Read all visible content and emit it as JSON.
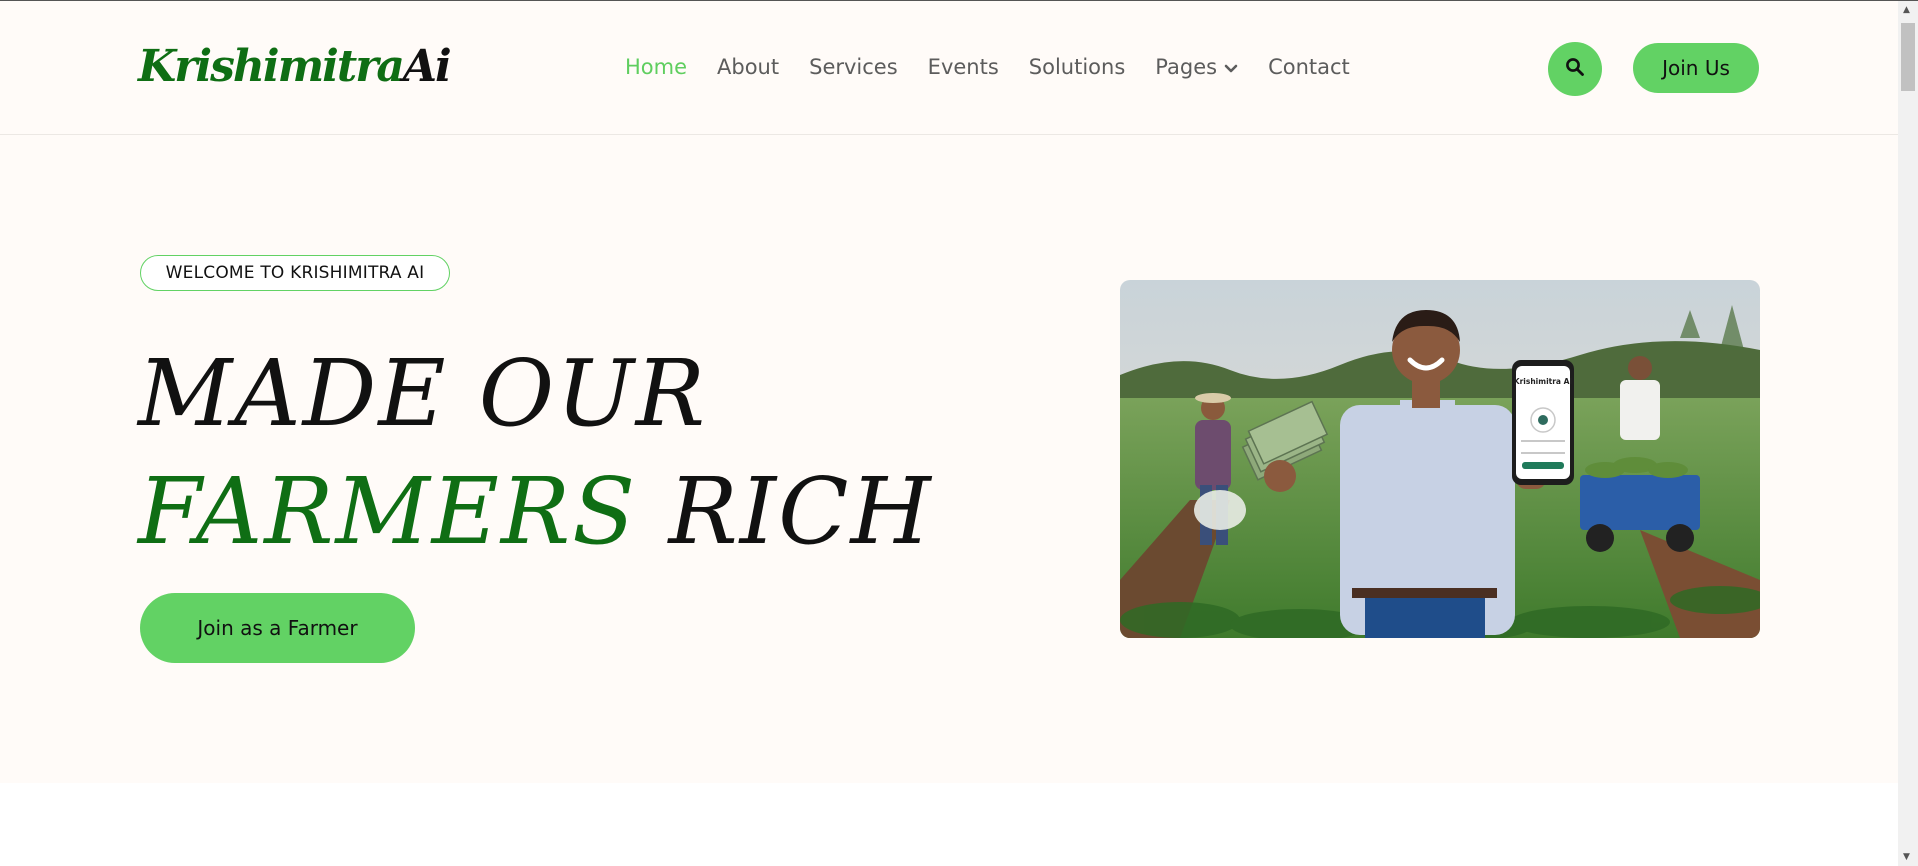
{
  "brand": {
    "logo_part1": "Krishimitra",
    "logo_part2": "Ai"
  },
  "nav": {
    "items": [
      "Home",
      "About",
      "Services",
      "Events",
      "Solutions",
      "Pages",
      "Contact"
    ],
    "active": "Home",
    "pages_dropdown_icon": "chevron-down-icon"
  },
  "header_actions": {
    "search_icon": "search-icon",
    "join_label": "Join Us"
  },
  "hero": {
    "badge": "WELCOME TO KRISHIMITRA AI",
    "headline_line1": "MADE OUR",
    "headline_green": "FARMERS",
    "headline_rest": "RICH",
    "cta_label": "Join as a Farmer",
    "phone_app_name": "Krishimitra AI"
  },
  "colors": {
    "accent": "#62d264",
    "brand_green": "#0f6e14",
    "background": "#fffbf8"
  }
}
